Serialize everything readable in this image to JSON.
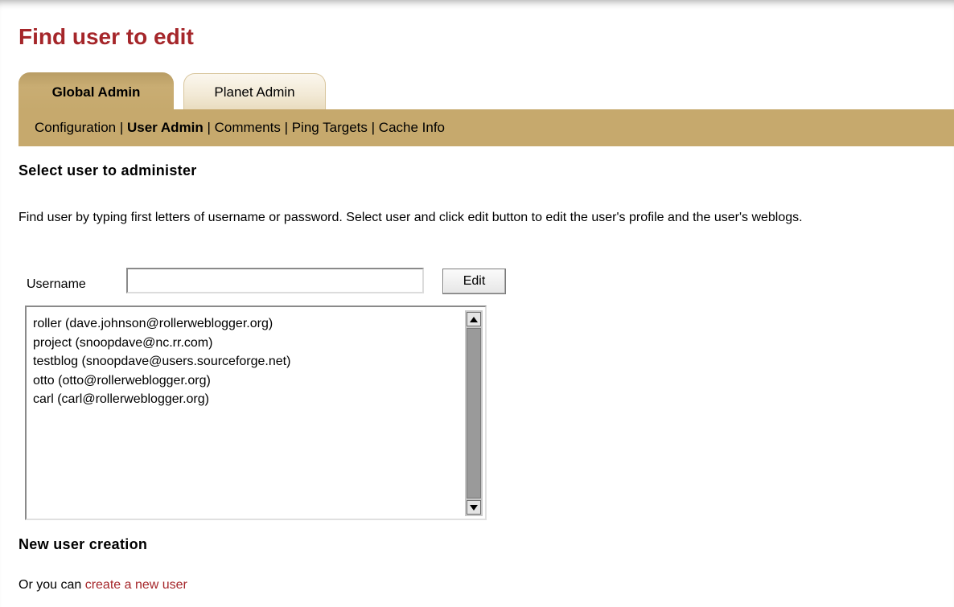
{
  "page": {
    "title": "Find user to edit"
  },
  "tabs": [
    {
      "label": "Global Admin",
      "active": true
    },
    {
      "label": "Planet Admin",
      "active": false
    }
  ],
  "admin_menu": {
    "items": [
      "Configuration",
      "User Admin",
      "Comments",
      "Ping Targets",
      "Cache Info"
    ],
    "active": "User Admin",
    "separator": " | "
  },
  "select_section": {
    "heading": "Select user to administer",
    "description": "Find user by typing first letters of username or password. Select user and click edit button to edit the user's profile and the user's weblogs."
  },
  "search": {
    "label": "Username",
    "value": "",
    "edit_label": "Edit"
  },
  "user_list": [
    "roller (dave.johnson@rollerweblogger.org)",
    "project (snoopdave@nc.rr.com)",
    "testblog (snoopdave@users.sourceforge.net)",
    "otto (otto@rollerweblogger.org)",
    "carl (carl@rollerweblogger.org)"
  ],
  "new_user_section": {
    "heading": "New user creation",
    "prefix": "Or you can ",
    "link": "create a new user"
  },
  "colors": {
    "title": "#a5262a",
    "tab_bar": "#c6a96d",
    "link": "#a5262a"
  }
}
